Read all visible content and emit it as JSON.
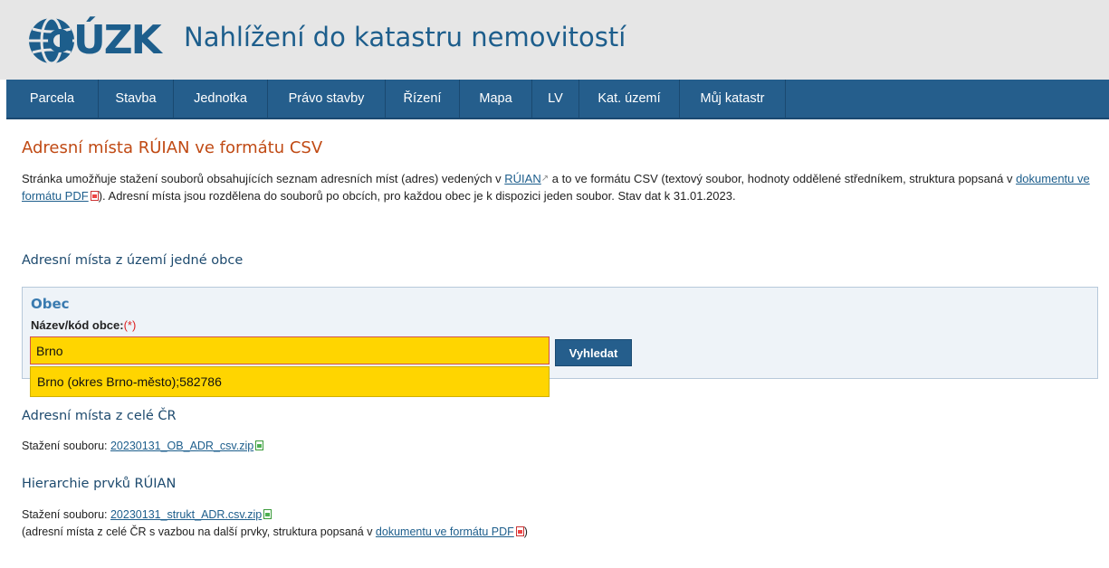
{
  "header": {
    "logo_text": "ČÚZK",
    "logo_letters": "ÚZK",
    "title": "Nahlížení do katastru nemovitostí"
  },
  "nav": {
    "items": [
      {
        "label": "Parcela"
      },
      {
        "label": "Stavba"
      },
      {
        "label": "Jednotka"
      },
      {
        "label": "Právo stavby"
      },
      {
        "label": "Řízení"
      },
      {
        "label": "Mapa"
      },
      {
        "label": "LV"
      },
      {
        "label": "Kat. území"
      },
      {
        "label": "Můj katastr"
      }
    ]
  },
  "page": {
    "title": "Adresní místa RÚIAN ve formátu CSV",
    "intro": {
      "p1": "Stránka umožňuje stažení souborů obsahujících seznam adresních míst (adres) vedených v ",
      "link_ruian": "RÚIAN",
      "p2": " a to ve formátu CSV (textový soubor, hodnoty oddělené středníkem, struktura popsaná v ",
      "link_pdf": "dokumentu ve formátu PDF",
      "p3": "). Adresní místa jsou rozdělena do souborů po obcích, pro každou obec je k dispozici jeden soubor. Stav dat k 31.01.2023."
    }
  },
  "section_obec": {
    "heading": "Adresní místa z území jedné obce",
    "legend": "Obec",
    "field_label": "Název/kód obce:",
    "required_mark": "(*)",
    "input_value": "Brno",
    "search_button": "Vyhledat",
    "suggestion": "Brno (okres Brno-město);582786"
  },
  "section_cr": {
    "heading": "Adresní místa z celé ČR",
    "download_label": "Stažení souboru: ",
    "file": "20230131_OB_ADR_csv.zip"
  },
  "section_hier": {
    "heading": "Hierarchie prvků RÚIAN",
    "download_label": "Stažení souboru: ",
    "file": "20230131_strukt_ADR.csv.zip",
    "note_before": "(adresní místa z celé ČR s vazbou na další prvky, struktura popsaná v ",
    "note_link": "dokumentu ve formátu PDF",
    "note_after": ")"
  },
  "colors": {
    "nav_bg": "#255e8c",
    "title_orange": "#c04a14",
    "input_highlight": "#ffd500"
  }
}
